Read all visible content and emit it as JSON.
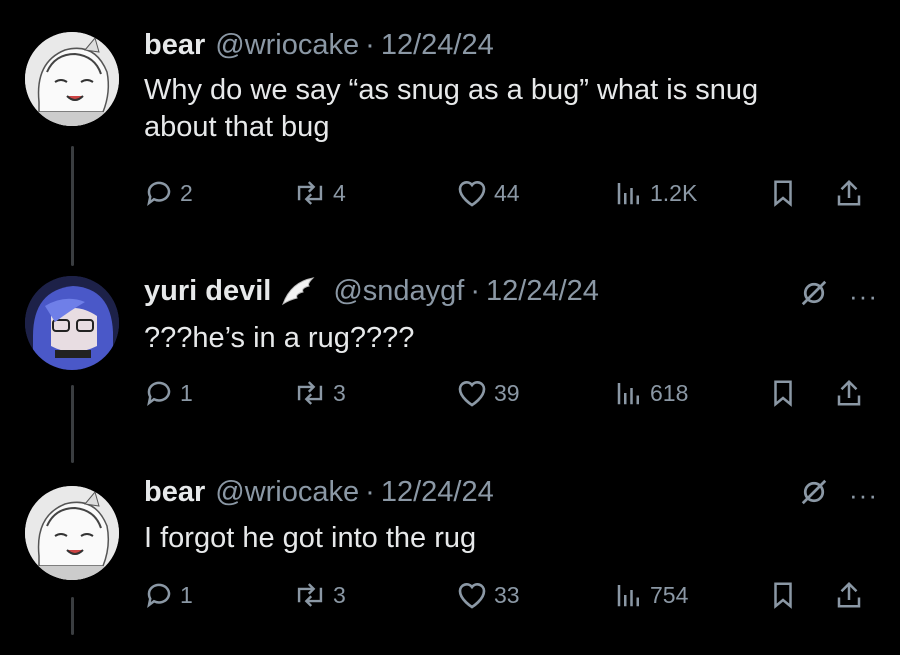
{
  "posts": [
    {
      "author": "bear",
      "handle": "@wriocake",
      "date": "12/24/24",
      "text_lines": [
        "Why do we say “as snug as a bug” what is snug",
        "about that bug"
      ],
      "replies": "2",
      "reposts": "4",
      "likes": "44",
      "views": "1.2K"
    },
    {
      "author": "yuri devil",
      "handle": "@sndaygf",
      "date": "12/24/24",
      "text_lines": [
        "???he’s in a rug????"
      ],
      "replies": "1",
      "reposts": "3",
      "likes": "39",
      "views": "618"
    },
    {
      "author": "bear",
      "handle": "@wriocake",
      "date": "12/24/24",
      "text_lines": [
        "I forgot he got into the rug"
      ],
      "replies": "1",
      "reposts": "3",
      "likes": "33",
      "views": "754"
    }
  ],
  "separator": "·",
  "more_label": "···",
  "colors": {
    "background": "#000000",
    "text": "#e7e9ea",
    "muted": "#8b98a5",
    "thread_line": "#3a3d40"
  },
  "icons": [
    "reply-icon",
    "repost-icon",
    "like-icon",
    "views-icon",
    "bookmark-icon",
    "share-icon",
    "grok-icon",
    "more-icon",
    "wing-icon"
  ]
}
